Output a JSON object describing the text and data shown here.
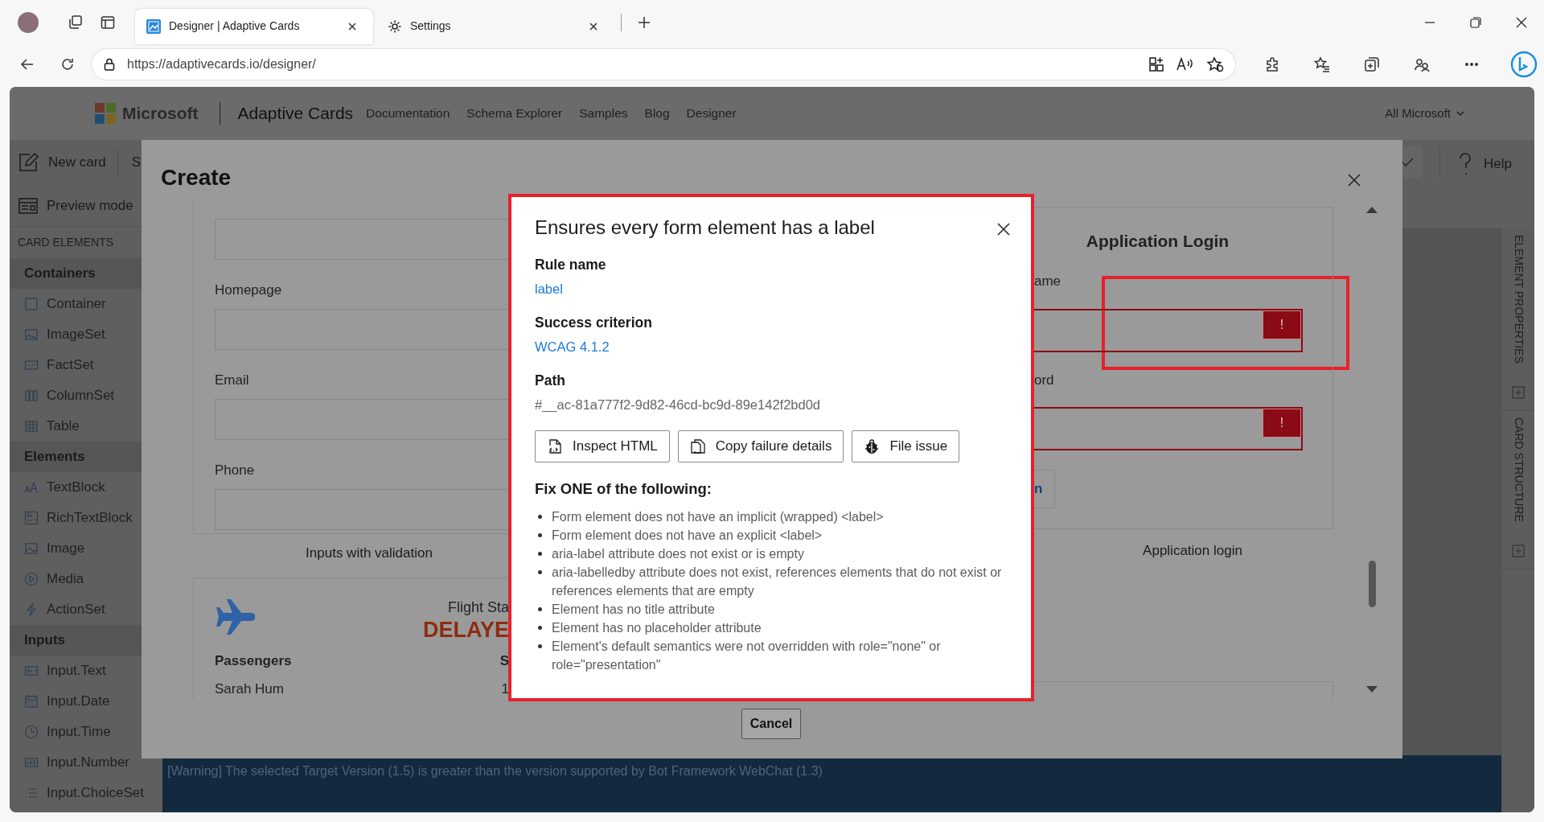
{
  "browser": {
    "tabs": [
      {
        "title": "Designer | Adaptive Cards",
        "selected": true
      },
      {
        "title": "Settings",
        "selected": false
      }
    ],
    "address": "https://adaptivecards.io/designer/"
  },
  "site_header": {
    "brand": "Microsoft",
    "product": "Adaptive Cards",
    "nav": [
      "Documentation",
      "Schema Explorer",
      "Samples",
      "Blog",
      "Designer"
    ],
    "menu": "All Microsoft"
  },
  "toolbar": {
    "new_card": "New card",
    "next_item": "S",
    "preview_mode": "Preview mode",
    "help": "Help"
  },
  "sidebar": {
    "title": "CARD ELEMENTS",
    "groups": [
      {
        "name": "Containers",
        "items": [
          "Container",
          "ImageSet",
          "FactSet",
          "ColumnSet",
          "Table"
        ]
      },
      {
        "name": "Elements",
        "items": [
          "TextBlock",
          "RichTextBlock",
          "Image",
          "Media",
          "ActionSet"
        ]
      },
      {
        "name": "Inputs",
        "items": [
          "Input.Text",
          "Input.Date",
          "Input.Time",
          "Input.Number",
          "Input.ChoiceSet"
        ]
      }
    ]
  },
  "side_tabs": [
    "ELEMENT PROPERTIES",
    "CARD STRUCTURE"
  ],
  "warning": "[Warning] The selected Target Version (1.5) is greater than the version supported by Bot Framework WebChat (1.3)",
  "create_dialog": {
    "title": "Create",
    "validation_card": {
      "fields": [
        {
          "kind": "input"
        },
        {
          "kind": "labeled",
          "label": "Homepage"
        },
        {
          "kind": "labeled",
          "label": "Email"
        },
        {
          "kind": "labeled",
          "label": "Phone"
        }
      ],
      "caption": "Inputs with validation"
    },
    "flight_card": {
      "status_label": "Flight Sta",
      "status": "DELAYE",
      "rows": [
        [
          "Passengers",
          "S"
        ],
        [
          "Sarah Hum",
          "1"
        ]
      ]
    },
    "login_card": {
      "title": "Application Login",
      "fields": [
        {
          "label": "ame",
          "invalid": true,
          "error_mark": "!",
          "highlighted": true
        },
        {
          "label": "ord",
          "invalid": true,
          "error_mark": "!",
          "highlighted": false
        }
      ],
      "button": "n",
      "caption": "Application login"
    },
    "cancel": "Cancel"
  },
  "rule_dialog": {
    "title": "Ensures every form element has a label",
    "sections": [
      {
        "heading": "Rule name",
        "value": "label",
        "kind": "link"
      },
      {
        "heading": "Success criterion",
        "value": "WCAG 4.1.2",
        "kind": "link"
      },
      {
        "heading": "Path",
        "value": "#__ac-81a777f2-9d82-46cd-bc9d-89e142f2bd0d",
        "kind": "text"
      }
    ],
    "buttons": [
      "Inspect HTML",
      "Copy failure details",
      "File issue"
    ],
    "fix_heading": "Fix ONE of the following:",
    "fixes": [
      "Form element does not have an implicit (wrapped) <label>",
      "Form element does not have an explicit <label>",
      "aria-label attribute does not exist or is empty",
      "aria-labelledby attribute does not exist, references elements that do not exist or references elements that are empty",
      "Element has no title attribute",
      "Element has no placeholder attribute",
      "Element's default semantics were not overridden with role=\"none\" or role=\"presentation\""
    ]
  }
}
